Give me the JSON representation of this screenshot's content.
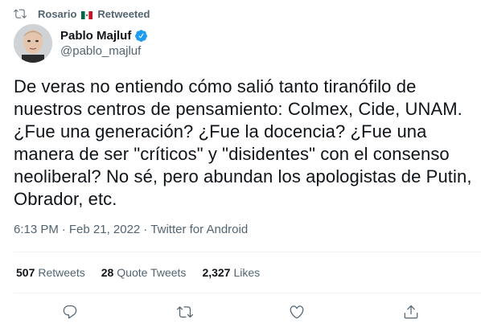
{
  "retweet_banner": {
    "user": "Rosario",
    "flag_icon": "mexico-flag-icon",
    "label": "Retweeted"
  },
  "author": {
    "display_name": "Pablo Majluf",
    "handle": "@pablo_majluf",
    "verified": true
  },
  "tweet": {
    "text": "De veras no entiendo cómo salió tanto tiranófilo de nuestros centros de pensamiento: Colmex, Cide, UNAM. ¿Fue una generación? ¿Fue la docencia? ¿Fue una manera de ser \"críticos\" y \"disidentes\" con el consenso neoliberal? No sé, pero abundan los apologistas de Putin, Obrador, etc."
  },
  "meta": {
    "time": "6:13 PM",
    "separator1": "·",
    "date": "Feb 21, 2022",
    "separator2": "·",
    "source": "Twitter for Android"
  },
  "stats": [
    {
      "count": "507",
      "label": "Retweets"
    },
    {
      "count": "28",
      "label": "Quote Tweets"
    },
    {
      "count": "2,327",
      "label": "Likes"
    }
  ],
  "actions": [
    {
      "name": "reply",
      "icon": "reply-icon"
    },
    {
      "name": "retweet",
      "icon": "retweet-icon"
    },
    {
      "name": "like",
      "icon": "heart-icon"
    },
    {
      "name": "share",
      "icon": "share-icon"
    }
  ],
  "colors": {
    "text_primary": "#0f1419",
    "text_secondary": "#536471",
    "verified": "#1d9bf0",
    "divider": "#eff3f4"
  }
}
